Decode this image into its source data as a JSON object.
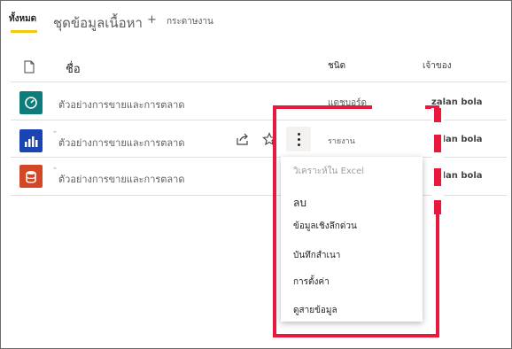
{
  "tabs": {
    "all": "ทั้งหมด",
    "datasets": "ชุดข้อมูลเนื้อหา",
    "plus": "+",
    "workbooks": "กระดาษงาน"
  },
  "columns": {
    "name": "ชื่อ",
    "type": "ชนิด",
    "owner": "เจ้าของ"
  },
  "rows": [
    {
      "icon": "dashboard-icon",
      "name": "ตัวอย่างการขายและการตลาด",
      "type": "แดชบอร์ด",
      "owner": "zalan bola",
      "color": "#0e7c7b"
    },
    {
      "icon": "report-icon",
      "name": "ตัวอย่างการขายและการตลาด",
      "type": "รายงาน",
      "owner": "zalan bola",
      "color": "#1a44b4"
    },
    {
      "icon": "dataset-icon",
      "name": "ตัวอย่างการขายและการตลาด",
      "type": "",
      "owner": "zalan bola",
      "color": "#d24726"
    }
  ],
  "menu": [
    "วิเคราะห์ใน Excel",
    "ลบ",
    "ข้อมูลเชิงลึกด่วน",
    "บันทึกสำเนา",
    "การตั้งค่า",
    "ดูสายข้อมูล"
  ],
  "colors": {
    "accent": "#f2c811",
    "highlight": "#e8193c"
  }
}
